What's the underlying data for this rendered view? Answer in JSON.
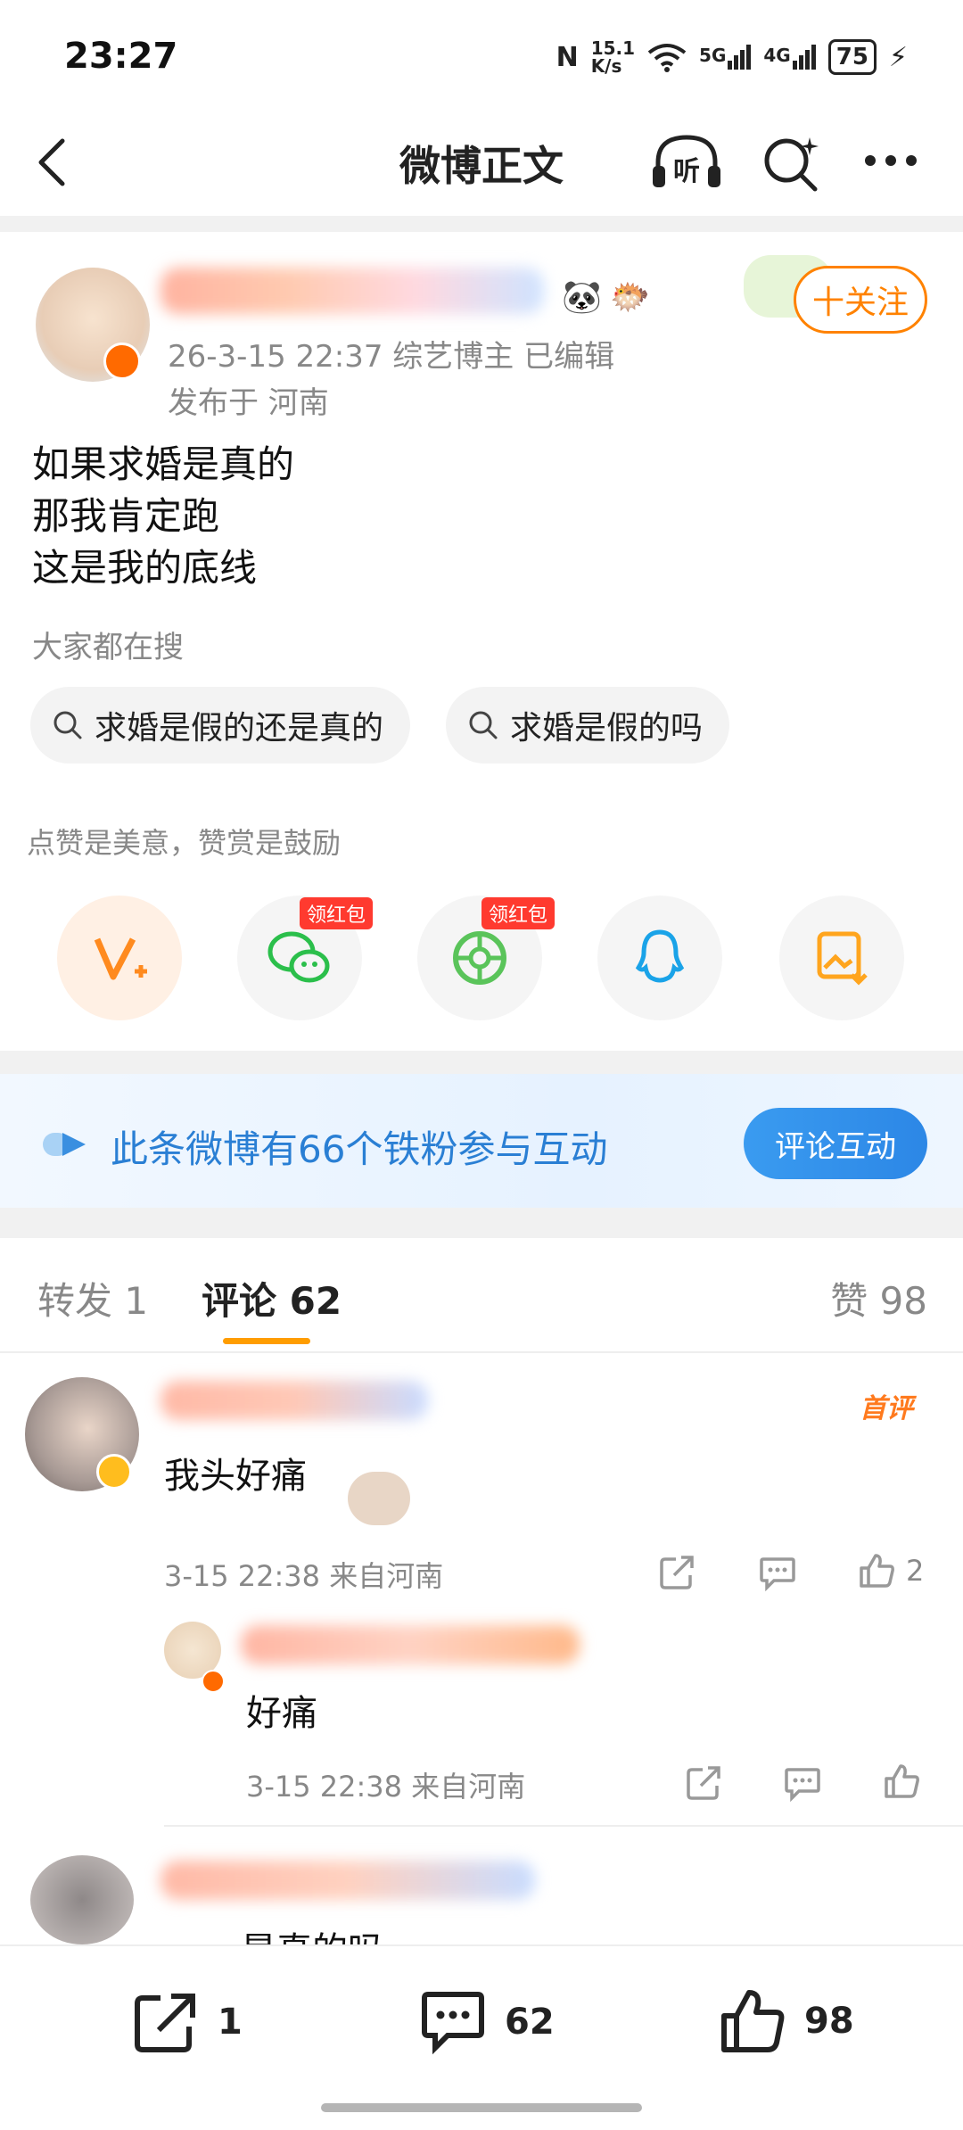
{
  "status_bar": {
    "time": "23:27",
    "net_speed_top": "15.1",
    "net_speed_bottom": "K/s",
    "sig1": "5G",
    "sig2": "4G",
    "battery": "75"
  },
  "nav": {
    "title": "微博正文"
  },
  "post": {
    "meta": "26-3-15 22:37  综艺博主  已编辑",
    "location": "发布于 河南",
    "follow_label": "十关注",
    "body": [
      "如果求婚是真的",
      "那我肯定跑",
      "这是我的底线"
    ],
    "search_label": "大家都在搜",
    "chips": [
      "求婚是假的还是真的",
      "求婚是假的吗"
    ],
    "reward_label": "点赞是美意，赞赏是鼓励",
    "share_badge": "领红包"
  },
  "fan_banner": {
    "text": "此条微博有66个铁粉参与互动",
    "button": "评论互动"
  },
  "tabs": {
    "repost": "转发 1",
    "comment": "评论 62",
    "like": "赞 98"
  },
  "comments": [
    {
      "badge": "首评",
      "text": "我头好痛",
      "time": "3-15 22:38",
      "source": "来自河南",
      "likes": "2"
    },
    {
      "text": "好痛",
      "time": "3-15 22:38",
      "source": "来自河南"
    },
    {
      "text": "是真的吗"
    }
  ],
  "bottom_bar": {
    "repost": "1",
    "comment": "62",
    "like": "98"
  },
  "colors": {
    "accent": "#ff8200",
    "link": "#2a7fd4",
    "tab_underline": "#ff9d00"
  }
}
